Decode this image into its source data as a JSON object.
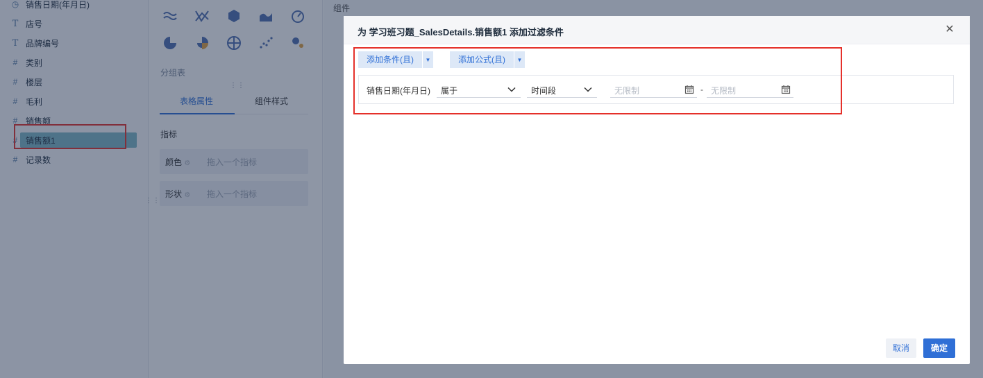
{
  "fields": [
    {
      "icon": "clock-icon",
      "glyph": "◷",
      "label": "销售日期(年月日)"
    },
    {
      "icon": "text-type-icon",
      "glyph": "T",
      "label": "店号"
    },
    {
      "icon": "text-type-icon",
      "glyph": "T",
      "label": "品牌编号"
    },
    {
      "icon": "number-type-icon",
      "glyph": "#",
      "label": "类别"
    },
    {
      "icon": "number-type-icon",
      "glyph": "#",
      "label": "楼层"
    },
    {
      "icon": "number-type-icon",
      "glyph": "#",
      "label": "毛利"
    },
    {
      "icon": "number-type-icon",
      "glyph": "#",
      "label": "销售额"
    },
    {
      "icon": "number-type-icon",
      "glyph": "#",
      "label": "销售额1"
    },
    {
      "icon": "calc-number-icon",
      "glyph": "#",
      "label": "记录数"
    }
  ],
  "config": {
    "group_table": "分组表",
    "tab_table_props": "表格属性",
    "tab_component_style": "组件样式",
    "metrics_label": "指标",
    "color_slot": "颜色",
    "shape_slot": "形状",
    "drop_placeholder": "拖入一个指标",
    "canvas_title": "组件"
  },
  "modal": {
    "title": "为 学习班习题_SalesDetails.销售额1 添加过滤条件",
    "add_condition": "添加条件(且)",
    "add_formula": "添加公式(且)",
    "condition": {
      "field": "销售日期(年月日)",
      "operator": "属于",
      "range_type": "时间段",
      "start_placeholder": "无限制",
      "separator": "-",
      "end_placeholder": "无限制"
    },
    "cancel": "取消",
    "confirm": "确定"
  },
  "colors": {
    "accent": "#2f6fd6",
    "highlight_box": "#e5302a",
    "selected_field": "#7fb9c7"
  }
}
